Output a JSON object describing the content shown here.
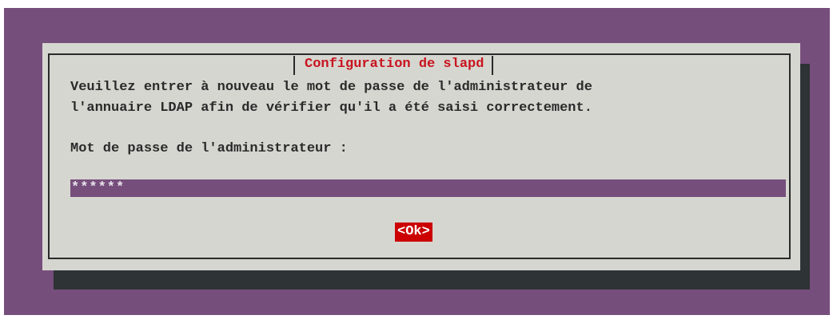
{
  "dialog": {
    "title": "Configuration de slapd",
    "message_line1": "Veuillez entrer à nouveau le mot de passe de l'administrateur de",
    "message_line2": "l'annuaire LDAP afin de vérifier qu'il a été saisi correctement.",
    "prompt_label": "Mot de passe de l'administrateur :",
    "password_value": "******",
    "ok_label": "<Ok>"
  },
  "colors": {
    "terminal_background": "#764e7c",
    "dialog_background": "#d6d6d0",
    "shadow": "#2e3336",
    "title_text": "#c8141e",
    "button_focus": "#cc0000"
  }
}
